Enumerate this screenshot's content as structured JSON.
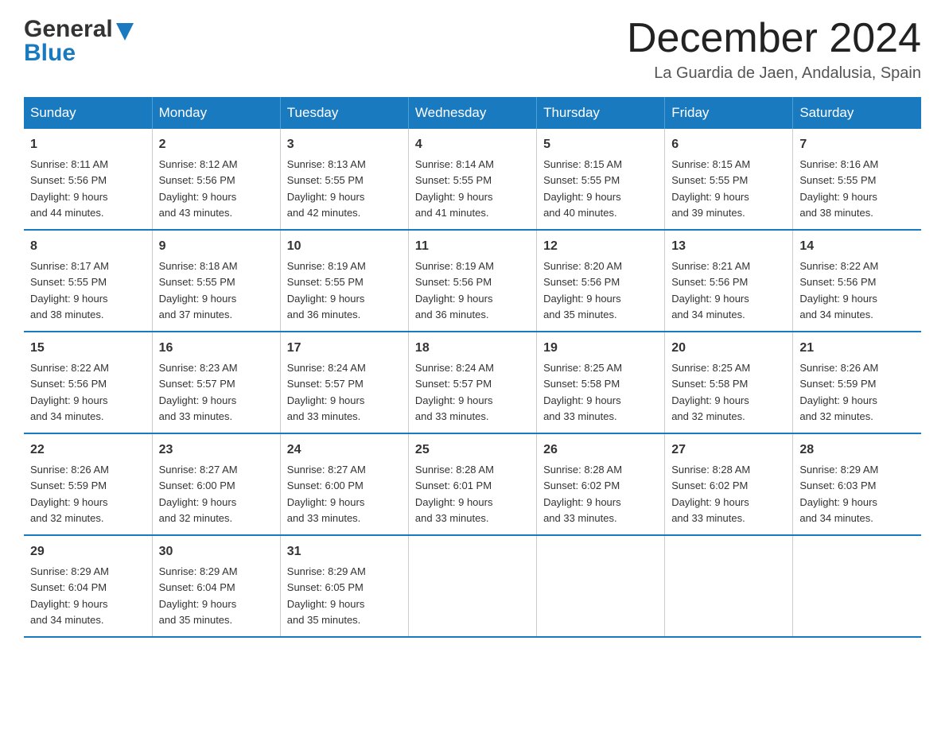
{
  "header": {
    "logo": {
      "general": "General",
      "blue": "Blue"
    },
    "title": "December 2024",
    "subtitle": "La Guardia de Jaen, Andalusia, Spain"
  },
  "days_of_week": [
    "Sunday",
    "Monday",
    "Tuesday",
    "Wednesday",
    "Thursday",
    "Friday",
    "Saturday"
  ],
  "weeks": [
    [
      {
        "day": "1",
        "sunrise": "8:11 AM",
        "sunset": "5:56 PM",
        "daylight": "9 hours and 44 minutes."
      },
      {
        "day": "2",
        "sunrise": "8:12 AM",
        "sunset": "5:56 PM",
        "daylight": "9 hours and 43 minutes."
      },
      {
        "day": "3",
        "sunrise": "8:13 AM",
        "sunset": "5:55 PM",
        "daylight": "9 hours and 42 minutes."
      },
      {
        "day": "4",
        "sunrise": "8:14 AM",
        "sunset": "5:55 PM",
        "daylight": "9 hours and 41 minutes."
      },
      {
        "day": "5",
        "sunrise": "8:15 AM",
        "sunset": "5:55 PM",
        "daylight": "9 hours and 40 minutes."
      },
      {
        "day": "6",
        "sunrise": "8:15 AM",
        "sunset": "5:55 PM",
        "daylight": "9 hours and 39 minutes."
      },
      {
        "day": "7",
        "sunrise": "8:16 AM",
        "sunset": "5:55 PM",
        "daylight": "9 hours and 38 minutes."
      }
    ],
    [
      {
        "day": "8",
        "sunrise": "8:17 AM",
        "sunset": "5:55 PM",
        "daylight": "9 hours and 38 minutes."
      },
      {
        "day": "9",
        "sunrise": "8:18 AM",
        "sunset": "5:55 PM",
        "daylight": "9 hours and 37 minutes."
      },
      {
        "day": "10",
        "sunrise": "8:19 AM",
        "sunset": "5:55 PM",
        "daylight": "9 hours and 36 minutes."
      },
      {
        "day": "11",
        "sunrise": "8:19 AM",
        "sunset": "5:56 PM",
        "daylight": "9 hours and 36 minutes."
      },
      {
        "day": "12",
        "sunrise": "8:20 AM",
        "sunset": "5:56 PM",
        "daylight": "9 hours and 35 minutes."
      },
      {
        "day": "13",
        "sunrise": "8:21 AM",
        "sunset": "5:56 PM",
        "daylight": "9 hours and 34 minutes."
      },
      {
        "day": "14",
        "sunrise": "8:22 AM",
        "sunset": "5:56 PM",
        "daylight": "9 hours and 34 minutes."
      }
    ],
    [
      {
        "day": "15",
        "sunrise": "8:22 AM",
        "sunset": "5:56 PM",
        "daylight": "9 hours and 34 minutes."
      },
      {
        "day": "16",
        "sunrise": "8:23 AM",
        "sunset": "5:57 PM",
        "daylight": "9 hours and 33 minutes."
      },
      {
        "day": "17",
        "sunrise": "8:24 AM",
        "sunset": "5:57 PM",
        "daylight": "9 hours and 33 minutes."
      },
      {
        "day": "18",
        "sunrise": "8:24 AM",
        "sunset": "5:57 PM",
        "daylight": "9 hours and 33 minutes."
      },
      {
        "day": "19",
        "sunrise": "8:25 AM",
        "sunset": "5:58 PM",
        "daylight": "9 hours and 33 minutes."
      },
      {
        "day": "20",
        "sunrise": "8:25 AM",
        "sunset": "5:58 PM",
        "daylight": "9 hours and 32 minutes."
      },
      {
        "day": "21",
        "sunrise": "8:26 AM",
        "sunset": "5:59 PM",
        "daylight": "9 hours and 32 minutes."
      }
    ],
    [
      {
        "day": "22",
        "sunrise": "8:26 AM",
        "sunset": "5:59 PM",
        "daylight": "9 hours and 32 minutes."
      },
      {
        "day": "23",
        "sunrise": "8:27 AM",
        "sunset": "6:00 PM",
        "daylight": "9 hours and 32 minutes."
      },
      {
        "day": "24",
        "sunrise": "8:27 AM",
        "sunset": "6:00 PM",
        "daylight": "9 hours and 33 minutes."
      },
      {
        "day": "25",
        "sunrise": "8:28 AM",
        "sunset": "6:01 PM",
        "daylight": "9 hours and 33 minutes."
      },
      {
        "day": "26",
        "sunrise": "8:28 AM",
        "sunset": "6:02 PM",
        "daylight": "9 hours and 33 minutes."
      },
      {
        "day": "27",
        "sunrise": "8:28 AM",
        "sunset": "6:02 PM",
        "daylight": "9 hours and 33 minutes."
      },
      {
        "day": "28",
        "sunrise": "8:29 AM",
        "sunset": "6:03 PM",
        "daylight": "9 hours and 34 minutes."
      }
    ],
    [
      {
        "day": "29",
        "sunrise": "8:29 AM",
        "sunset": "6:04 PM",
        "daylight": "9 hours and 34 minutes."
      },
      {
        "day": "30",
        "sunrise": "8:29 AM",
        "sunset": "6:04 PM",
        "daylight": "9 hours and 35 minutes."
      },
      {
        "day": "31",
        "sunrise": "8:29 AM",
        "sunset": "6:05 PM",
        "daylight": "9 hours and 35 minutes."
      },
      null,
      null,
      null,
      null
    ]
  ],
  "labels": {
    "sunrise": "Sunrise:",
    "sunset": "Sunset:",
    "daylight": "Daylight:"
  }
}
